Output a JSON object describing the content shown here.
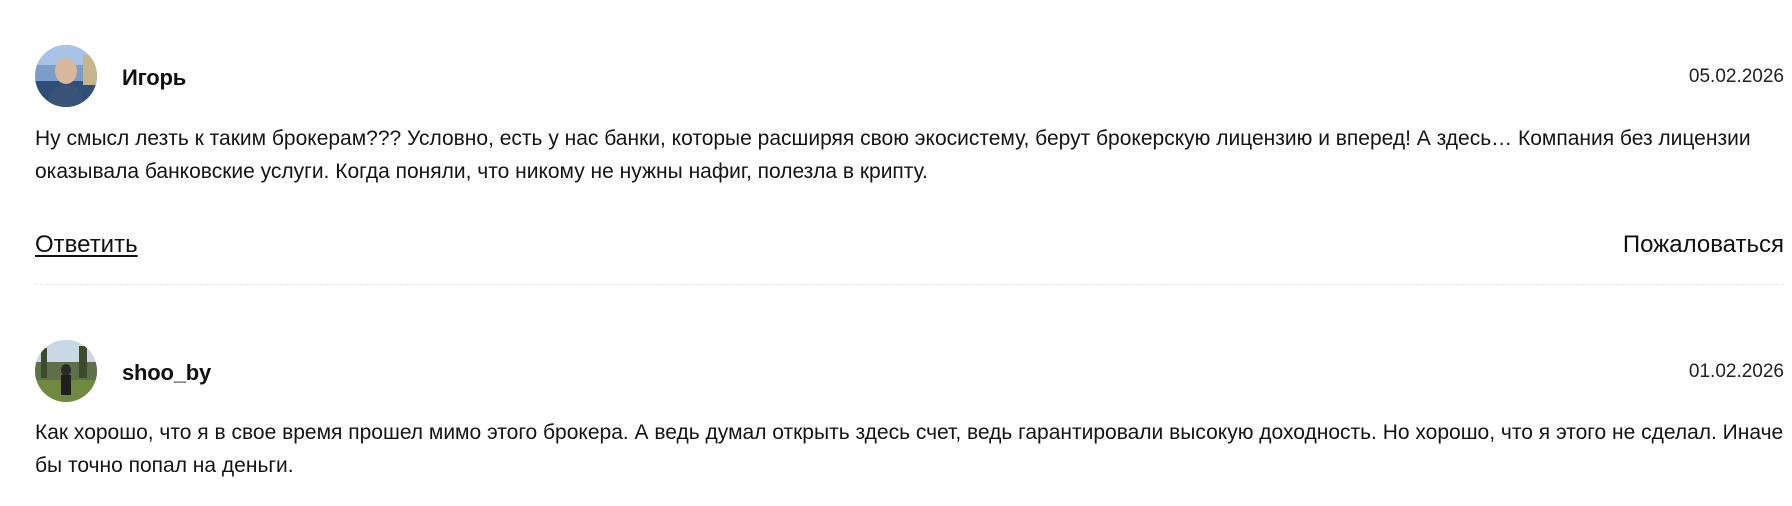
{
  "comments": [
    {
      "author": "Игорь",
      "date": "05.02.2026",
      "text": "Ну смысл лезть к таким брокерам??? Условно, есть у нас банки, которые расширяя свою экосистему, берут брокерскую лицензию и вперед! А здесь… Компания без лицензии оказывала банковские услуги. Когда поняли, что никому не нужны нафиг, полезла в крипту.",
      "reply_label": "Ответить",
      "report_label": "Пожаловаться"
    },
    {
      "author": "shoo_by",
      "date": "01.02.2026",
      "text": "Как хорошо, что я в свое время прошел мимо этого брокера. А ведь думал открыть здесь счет, ведь гарантировали высокую доходность. Но хорошо, что я этого не сделал. Иначе бы точно попал на деньги."
    }
  ]
}
